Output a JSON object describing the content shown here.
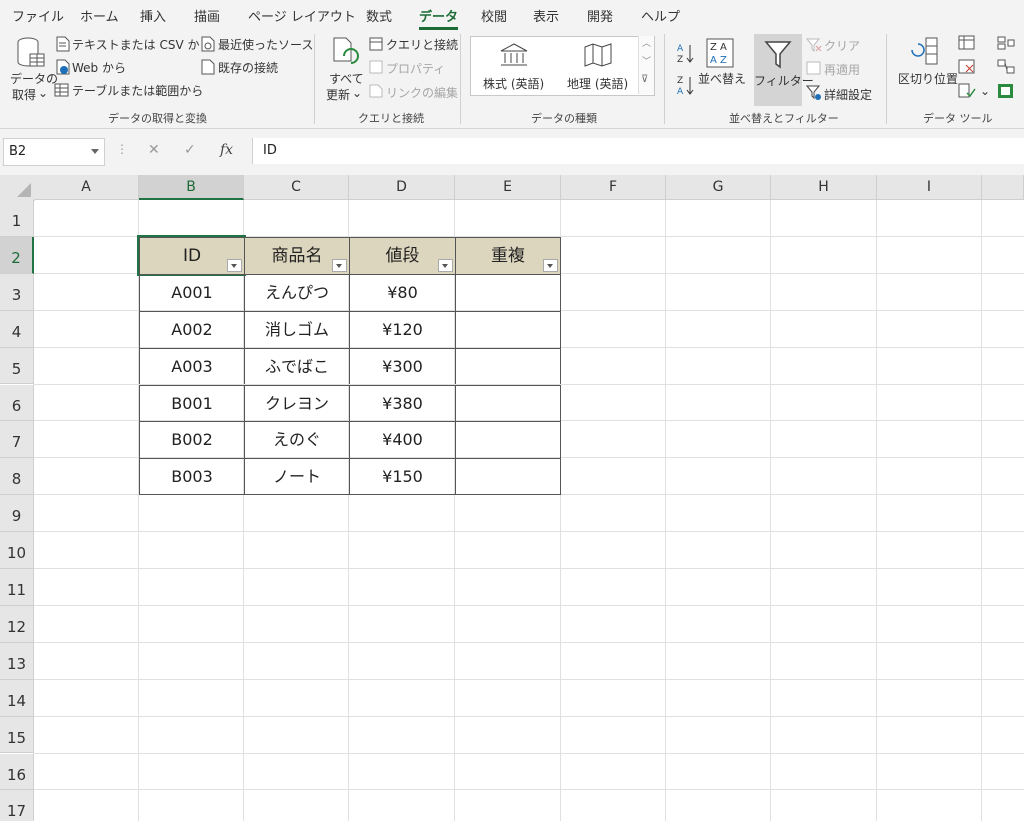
{
  "ribbon_tabs": [
    "ファイル",
    "ホーム",
    "挿入",
    "描画",
    "ページ レイアウト",
    "数式",
    "データ",
    "校閲",
    "表示",
    "開発",
    "ヘルプ"
  ],
  "active_tab": "データ",
  "groups": {
    "get_data": {
      "label": "データの取得と変換",
      "get_data_line1": "データの",
      "get_data_line2": "取得",
      "text_csv": "テキストまたは CSV から",
      "web": "Web から",
      "table_range": "テーブルまたは範囲から",
      "recent_sources": "最近使ったソース",
      "existing_conn": "既存の接続"
    },
    "queries": {
      "label": "クエリと接続",
      "refresh_line1": "すべて",
      "refresh_line2": "更新",
      "queries_conn": "クエリと接続",
      "properties": "プロパティ",
      "edit_links": "リンクの編集"
    },
    "data_types": {
      "label": "データの種類",
      "stocks": "株式 (英語)",
      "geography": "地理 (英語)"
    },
    "sort_filter": {
      "label": "並べ替えとフィルター",
      "sort": "並べ替え",
      "filter": "フィルター",
      "clear": "クリア",
      "reapply": "再適用",
      "advanced": "詳細設定"
    },
    "data_tools": {
      "label": "データ ツール",
      "text_to_columns": "区切り位置"
    }
  },
  "formula_bar": {
    "name_box": "B2",
    "fx": "fx",
    "value": "ID"
  },
  "columns": [
    "A",
    "B",
    "C",
    "D",
    "E",
    "F",
    "G",
    "H",
    "I"
  ],
  "rows": [
    "1",
    "2",
    "3",
    "4",
    "5",
    "6",
    "7",
    "8",
    "9",
    "10",
    "11",
    "12",
    "13",
    "14",
    "15",
    "16",
    "17"
  ],
  "table": {
    "headers": [
      "ID",
      "商品名",
      "値段",
      "重複"
    ],
    "rows": [
      [
        "A001",
        "えんぴつ",
        "¥80",
        ""
      ],
      [
        "A002",
        "消しゴム",
        "¥120",
        ""
      ],
      [
        "A003",
        "ふでばこ",
        "¥300",
        ""
      ],
      [
        "B001",
        "クレヨン",
        "¥380",
        ""
      ],
      [
        "B002",
        "えのぐ",
        "¥400",
        ""
      ],
      [
        "B003",
        "ノート",
        "¥150",
        ""
      ]
    ]
  },
  "colors": {
    "accent": "#217346",
    "table_header_fill": "#ddd6bf"
  }
}
